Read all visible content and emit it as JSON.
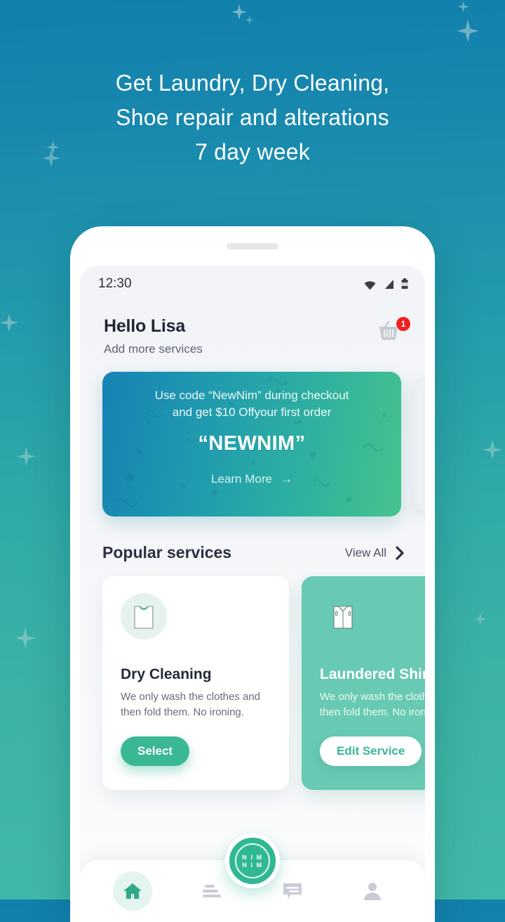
{
  "theme": {
    "bg_top": "#1180ad",
    "bg_bottom": "#41b9a8",
    "accent_green": "#3ab795",
    "mint_card": "#68c9b4",
    "badge_red": "#f02020"
  },
  "headline": {
    "line1": "Get Laundry, Dry Cleaning,",
    "line2": "Shoe repair and alterations",
    "line3": "7 day week"
  },
  "phone": {
    "statusbar": {
      "time": "12:30",
      "icons": [
        "wifi-icon",
        "cellular-signal-icon",
        "battery-icon"
      ]
    },
    "header": {
      "greeting": "Hello Lisa",
      "subtitle": "Add more services",
      "cart_icon": "shopping-basket-icon",
      "cart_badge": "1"
    },
    "promo": {
      "line1": "Use code “NewNim” during checkout",
      "line2": "and get $10 Offyour first order",
      "code": "“NEWNIM”",
      "learn_more": "Learn More",
      "learn_more_arrow": "→"
    },
    "section": {
      "title": "Popular services",
      "view_all": "View All",
      "view_all_chevron": "›"
    },
    "services": [
      {
        "icon": "folded-tshirt-icon",
        "title": "Dry Cleaning",
        "desc_line1": "We only wash the clothes and",
        "desc_line2": "then fold them. No ironing.",
        "button": "Select",
        "style": "light"
      },
      {
        "icon": "folded-shirt-icon",
        "title": "Laundered Shirts",
        "desc_line1": "We only wash the clothes and",
        "desc_line2": "then fold them. No ironing.",
        "button": "Edit Service",
        "style": "mint"
      }
    ],
    "navbar": {
      "items": [
        {
          "icon": "home-icon",
          "active": true
        },
        {
          "icon": "list-icon",
          "active": false
        },
        {
          "icon": "chat-icon",
          "active": false
        },
        {
          "icon": "profile-icon",
          "active": false
        }
      ],
      "fab": {
        "line1": "N I M",
        "line2": "N I M"
      }
    }
  }
}
